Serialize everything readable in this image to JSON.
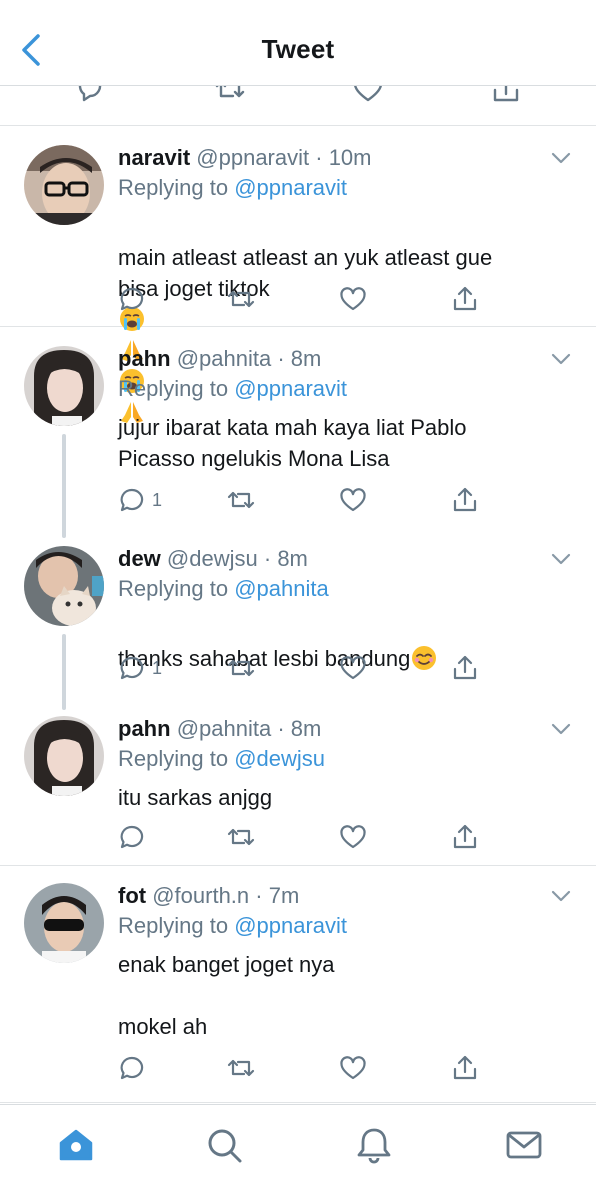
{
  "header": {
    "title": "Tweet",
    "back_icon": "chevron-left-icon"
  },
  "colors": {
    "accent": "#3b94d9",
    "muted": "#657786",
    "text": "#14171a",
    "divider": "#e1e4e6"
  },
  "tweets": [
    {
      "name": "naravit",
      "handle": "@ppnaravit",
      "time": "10m",
      "replying_label": "Replying to",
      "replying_to": "@ppnaravit",
      "text": "main atleast atleast an yuk atleast gue bisa joget tiktok",
      "emojis": [
        "loudly-crying-face",
        "folded-hands",
        "loudly-crying-face",
        "folded-hands"
      ],
      "reply_count": ""
    },
    {
      "name": "pahn",
      "handle": "@pahnita",
      "time": "8m",
      "replying_label": "Replying to",
      "replying_to": "@ppnaravit",
      "text": "jujur ibarat kata mah kaya liat Pablo Picasso ngelukis Mona Lisa",
      "reply_count": "1"
    },
    {
      "name": "dew",
      "handle": "@dewjsu",
      "time": "8m",
      "replying_label": "Replying to",
      "replying_to": "@pahnita",
      "text": "thanks sahabat lesbi bandung",
      "emojis": [
        "smiling-face-with-smiling-eyes"
      ],
      "reply_count": "1"
    },
    {
      "name": "pahn",
      "handle": "@pahnita",
      "time": "8m",
      "replying_label": "Replying to",
      "replying_to": "@dewjsu",
      "text": "itu sarkas anjgg",
      "reply_count": ""
    },
    {
      "name": "fot",
      "handle": "@fourth.n",
      "time": "7m",
      "replying_label": "Replying to",
      "replying_to": "@ppnaravit",
      "text": "enak banget joget nya\n\nmokel ah",
      "reply_count": ""
    }
  ],
  "tabbar": {
    "items": [
      "home-icon",
      "search-icon",
      "notifications-bell-icon",
      "messages-envelope-icon"
    ],
    "active": "home-icon"
  }
}
